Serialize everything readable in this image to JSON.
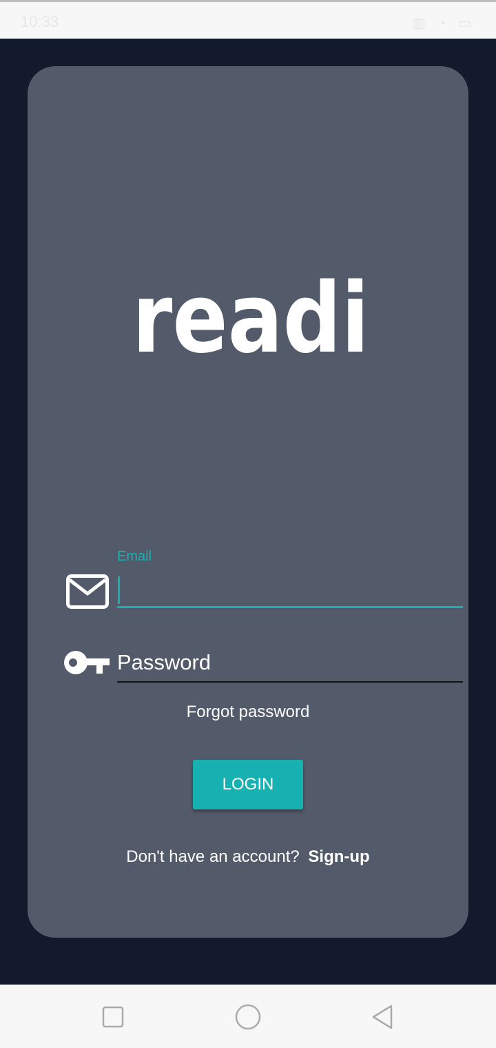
{
  "status_bar": {
    "time": "10:33",
    "icons": [
      "vibrate-icon",
      "alarm-icon",
      "battery-icon"
    ]
  },
  "app": {
    "logo_text": "readi",
    "email": {
      "label": "Email",
      "value": ""
    },
    "password": {
      "placeholder": "Password",
      "value": ""
    },
    "forgot_password": "Forgot password",
    "login_button": "LOGIN",
    "signup_prompt": "Don't have an account?",
    "signup_link": "Sign-up"
  },
  "colors": {
    "accent": "#17b1b1",
    "card": "#535a69",
    "background": "#131a2c"
  },
  "nav_bar": {
    "buttons": [
      "recents-button",
      "home-button",
      "back-button"
    ]
  }
}
